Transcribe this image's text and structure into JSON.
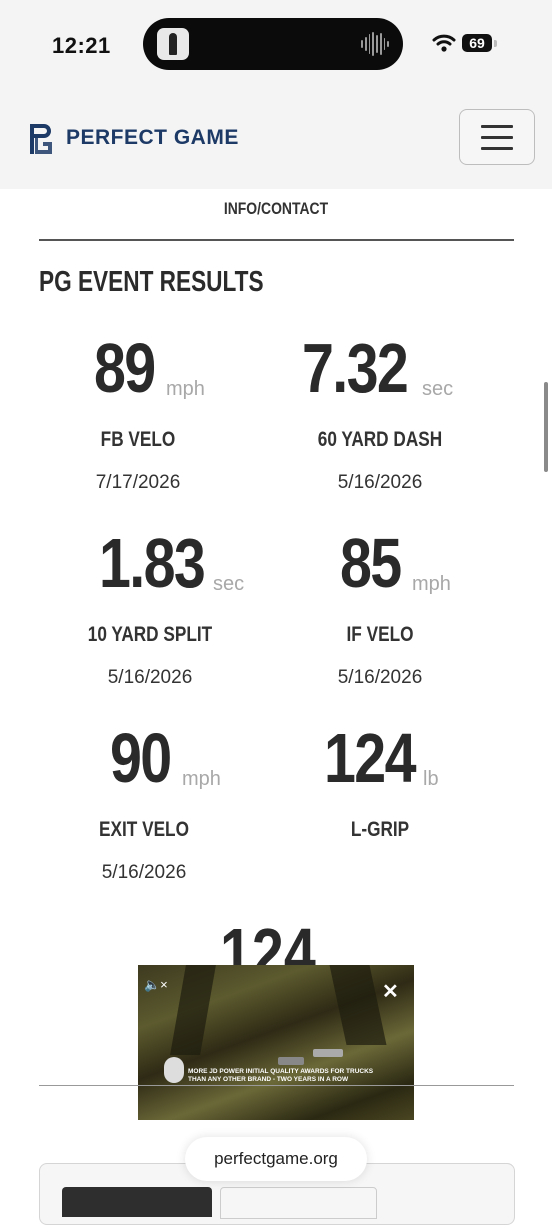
{
  "status_bar": {
    "time": "12:21",
    "battery": "69",
    "icons": [
      "media-thumbnail-icon",
      "audio-waveform-icon",
      "wifi-icon",
      "battery-icon"
    ]
  },
  "header": {
    "brand": "PERFECT GAME",
    "logo_icon": "pg-logo-icon",
    "menu_icon": "hamburger-menu-icon",
    "brand_color": "#1d3a66"
  },
  "nav": {
    "info_contact": "INFO/CONTACT"
  },
  "section": {
    "title": "PG EVENT RESULTS",
    "stats": [
      {
        "value": "89",
        "unit": "mph",
        "label": "FB VELO",
        "date": "7/17/2026"
      },
      {
        "value": "7.32",
        "unit": "sec",
        "label": "60 YARD DASH",
        "date": "5/16/2026"
      },
      {
        "value": "1.83",
        "unit": "sec",
        "label": "10 YARD SPLIT",
        "date": "5/16/2026"
      },
      {
        "value": "85",
        "unit": "mph",
        "label": "IF VELO",
        "date": "5/16/2026"
      },
      {
        "value": "90",
        "unit": "mph",
        "label": "EXIT VELO",
        "date": "5/16/2026"
      },
      {
        "value": "124",
        "unit": "lb",
        "label": "L-GRIP",
        "date": ""
      }
    ],
    "partial_value": "124"
  },
  "ad": {
    "mute_icon": "speaker-muted-icon",
    "close_icon": "close-icon",
    "headline_line1": "MORE JD POWER INITIAL QUALITY AWARDS FOR TRUCKS",
    "headline_line2": "THAN ANY OTHER BRAND - TWO YEARS IN A ROW"
  },
  "browser": {
    "url": "perfectgame.org"
  }
}
